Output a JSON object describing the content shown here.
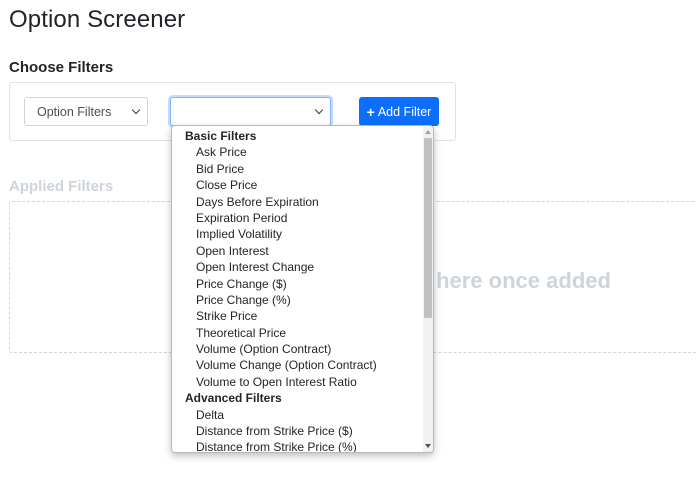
{
  "page": {
    "title": "Option Screener"
  },
  "choose_filters": {
    "title": "Choose Filters",
    "filter_type_select": {
      "value": "Option Filters"
    },
    "filter_select": {
      "value": ""
    },
    "add_button": {
      "icon": "plus-icon",
      "label": "Add Filter"
    }
  },
  "applied_filters": {
    "title": "Applied Filters",
    "placeholder": "own here once added"
  },
  "dropdown": {
    "groups": [
      {
        "label": "Basic Filters",
        "options": [
          "Ask Price",
          "Bid Price",
          "Close Price",
          "Days Before Expiration",
          "Expiration Period",
          "Implied Volatility",
          "Open Interest",
          "Open Interest Change",
          "Price Change ($)",
          "Price Change (%)",
          "Strike Price",
          "Theoretical Price",
          "Volume (Option Contract)",
          "Volume Change (Option Contract)",
          "Volume to Open Interest Ratio"
        ]
      },
      {
        "label": "Advanced Filters",
        "options": [
          "Delta",
          "Distance from Strike Price ($)",
          "Distance from Strike Price (%)"
        ]
      }
    ]
  },
  "colors": {
    "primary": "#0d6efd",
    "muted": "#ced4da",
    "text": "#212529"
  }
}
